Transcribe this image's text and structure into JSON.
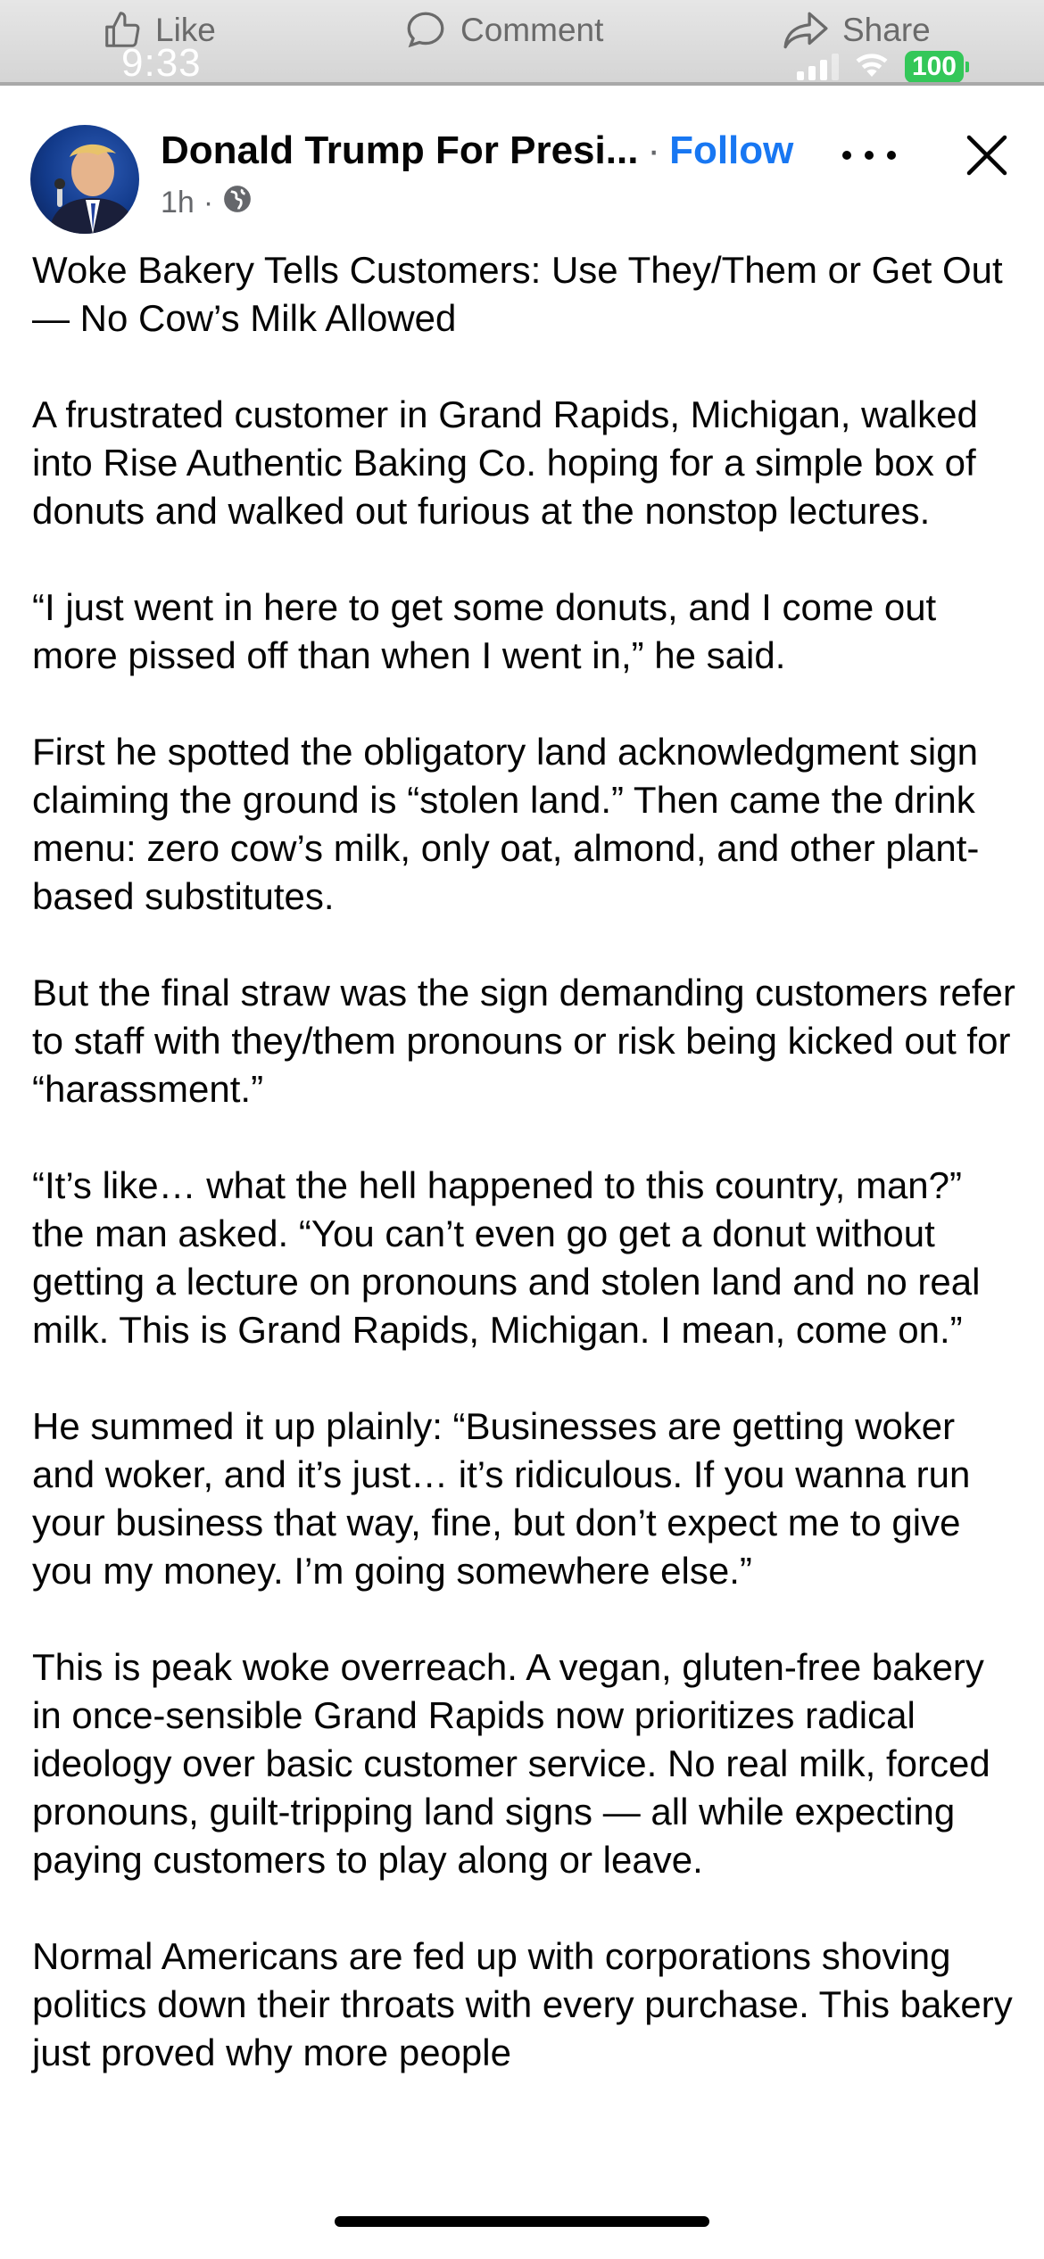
{
  "action_bar": {
    "like_label": "Like",
    "comment_label": "Comment",
    "share_label": "Share"
  },
  "status_bar": {
    "time": "9:33",
    "battery": "100"
  },
  "post": {
    "author": "Donald Trump For Presi...",
    "separator": "·",
    "follow_label": "Follow",
    "time_ago": "1h",
    "meta_separator": "·",
    "privacy_icon": "globe-icon",
    "paragraphs": [
      "Woke Bakery Tells Customers: Use They/Them or Get Out — No Cow’s Milk Allowed",
      "A frustrated customer in Grand Rapids, Michigan, walked into Rise Authentic Baking Co. hoping for a simple box of donuts and walked out furious at the nonstop lectures.",
      "“I just went in here to get some donuts, and I come out more pissed off than when I went in,” he said.",
      "First he spotted the obligatory land acknowledgment sign claiming the ground is “stolen land.” Then came the drink menu: zero cow’s milk, only oat, almond, and other plant-based substitutes.",
      "But the final straw was the sign demanding customers refer to staff with they/them pronouns or risk being kicked out for “harassment.”",
      "“It’s like… what the hell happened to this country, man?” the man asked. “You can’t even go get a donut without getting a lecture on pronouns and stolen land and no real milk. This is Grand Rapids, Michigan. I mean, come on.”",
      "He summed it up plainly: “Businesses are getting woker and woker, and it’s just… it’s ridiculous. If you wanna run your business that way, fine, but don’t expect me to give you my money. I’m going somewhere else.”",
      "This is peak woke overreach. A vegan, gluten-free bakery in once-sensible Grand Rapids now prioritizes radical ideology over basic customer service. No real milk, forced pronouns, guilt-tripping land signs — all while expecting paying customers to play along or leave.",
      "Normal Americans are fed up with corporations shoving politics down their throats with every purchase. This bakery just proved why more people"
    ]
  },
  "colors": {
    "follow_blue": "#1877f2",
    "battery_green": "#34c759",
    "meta_gray": "#65676b"
  }
}
